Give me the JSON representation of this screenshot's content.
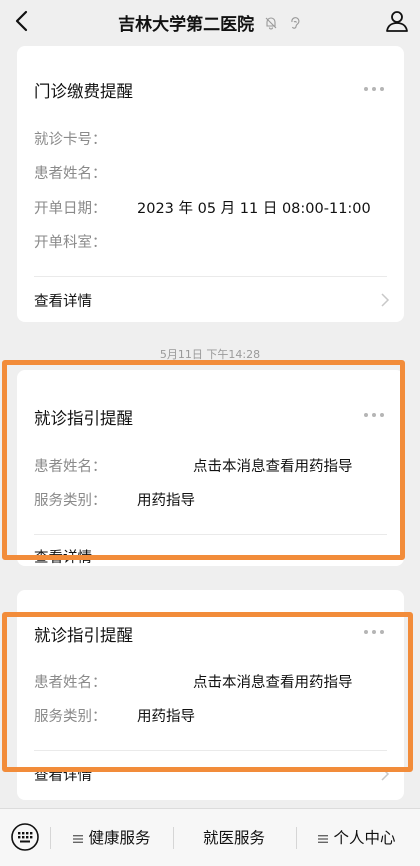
{
  "header": {
    "title": "吉林大学第二医院",
    "back_icon": "chevron-left-icon",
    "bell_icon": "bell-muted-icon",
    "ear_icon": "ear-icon",
    "user_icon": "user-icon"
  },
  "cards": [
    {
      "title": "门诊缴费提醒",
      "rows": [
        {
          "label": "就诊卡号：",
          "value": ""
        },
        {
          "label": "患者姓名：",
          "value": ""
        },
        {
          "label": "开单日期：",
          "value": "2023 年 05 月 11 日 08:00-11:00"
        },
        {
          "label": "开单科室：",
          "value": ""
        }
      ],
      "detail_label": "查看详情"
    },
    {
      "title": "就诊指引提醒",
      "rows": [
        {
          "label": "患者姓名：",
          "value": "点击本消息查看用药指导"
        },
        {
          "label": "服务类别：",
          "value": "用药指导"
        }
      ],
      "detail_label": "查看详情"
    },
    {
      "title": "就诊指引提醒",
      "rows": [
        {
          "label": "患者姓名：",
          "value": "点击本消息查看用药指导"
        },
        {
          "label": "服务类别：",
          "value": "用药指导"
        }
      ],
      "detail_label": "查看详情"
    }
  ],
  "timestamp": "5月11日 下午14:28",
  "bottom_menu": {
    "keyboard_icon": "keyboard-icon",
    "items": [
      {
        "label": "健康服务",
        "has_submenu": true
      },
      {
        "label": "就医服务",
        "has_submenu": false
      },
      {
        "label": "个人中心",
        "has_submenu": true
      }
    ]
  },
  "colors": {
    "highlight": "#f28c3a",
    "background": "#efefef",
    "card": "#ffffff",
    "label": "#8a8a8a"
  }
}
